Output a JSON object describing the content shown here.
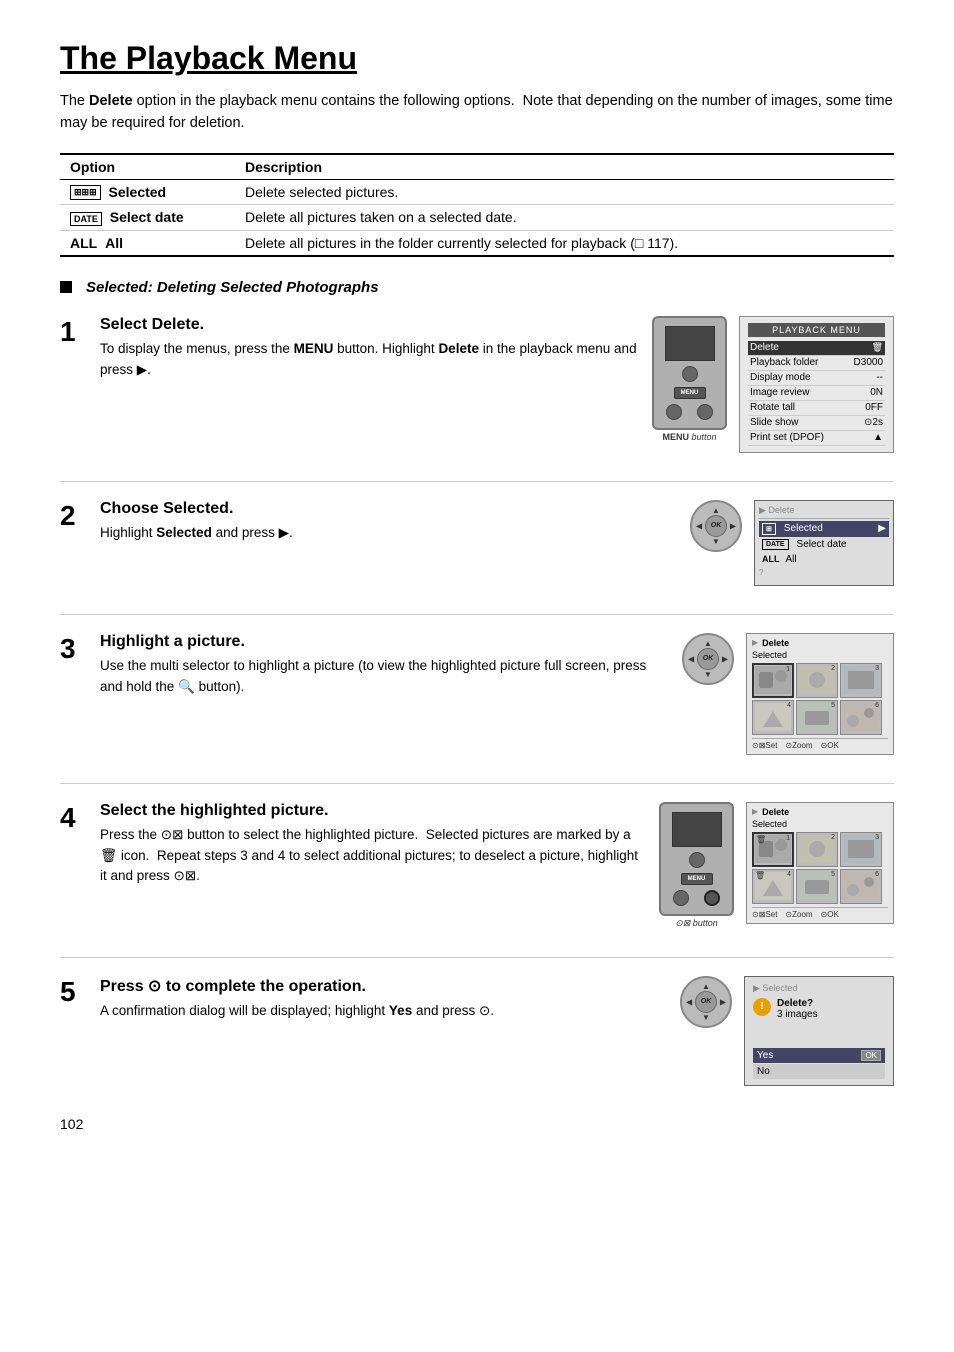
{
  "page": {
    "title": "The Playback Menu",
    "page_number": "102",
    "intro": "The Delete option in the playback menu contains the following options.  Note that depending on the number of images, some time may be required for deletion.",
    "table": {
      "headers": [
        "Option",
        "Description"
      ],
      "rows": [
        {
          "icon": "BBB",
          "option": "Selected",
          "description": "Delete selected pictures."
        },
        {
          "icon": "DATE",
          "option": "Select date",
          "description": "Delete all pictures taken on a selected date."
        },
        {
          "icon": "ALL",
          "option": "All",
          "description": "Delete all pictures in the folder currently selected for playback (□ 117)."
        }
      ]
    },
    "section_heading": "Selected: Deleting Selected Photographs",
    "steps": [
      {
        "number": "1",
        "title": "Select Delete.",
        "body": "To display the menus, press the MENU button. Highlight Delete in the playback menu and press ▶.",
        "button_label": "MENU button",
        "screen": {
          "title": "PLAYBACK MENU",
          "rows": [
            {
              "label": "Delete",
              "value": "",
              "highlighted": true
            },
            {
              "label": "Playback folder",
              "value": "D3000"
            },
            {
              "label": "Display mode",
              "value": "--"
            },
            {
              "label": "Image review",
              "value": "0N"
            },
            {
              "label": "Rotate tall",
              "value": "0FF"
            },
            {
              "label": "Slide show",
              "value": "⊙2s"
            },
            {
              "label": "Print set (DPOF)",
              "value": "▲"
            }
          ]
        }
      },
      {
        "number": "2",
        "title": "Choose Selected.",
        "body": "Highlight Selected and press ▶.",
        "screen": {
          "title": "Delete",
          "rows": [
            {
              "label": "Selected",
              "value": "▶",
              "highlighted": true,
              "icon": "BBB"
            },
            {
              "label": "Select date",
              "value": "",
              "icon": "DATE"
            },
            {
              "label": "All  All",
              "value": "",
              "icon": ""
            }
          ]
        }
      },
      {
        "number": "3",
        "title": "Highlight a picture.",
        "body": "Use the multi selector to highlight a picture (to view the highlighted picture full screen, press and hold the 🔍 button).",
        "screen": {
          "title": "Delete",
          "subtitle": "Selected",
          "has_thumbnails": true,
          "footer": "⊙⊠Set  ⊙Zoom  ⊙OK"
        }
      },
      {
        "number": "4",
        "title": "Select the highlighted picture.",
        "body": "Press the ⊙⊠ button to select the highlighted picture.  Selected pictures are marked by a 🗑 icon.  Repeat steps 3 and 4 to select additional pictures; to deselect a picture, highlight it and press ⊙⊠.",
        "button_label": "⊙⊠ button",
        "screen": {
          "title": "Delete",
          "subtitle": "Selected",
          "has_thumbnails": true,
          "has_delete_marks": true,
          "footer": "⊙⊠Set  ⊙Zoom  ⊙OK"
        }
      },
      {
        "number": "5",
        "title": "Press ⊙ to complete the operation.",
        "body": "A confirmation dialog will be displayed; highlight Yes and press ⊙.",
        "screen": {
          "title": "Selected",
          "confirm": {
            "icon": "!",
            "message": "Delete?",
            "sub": "3 images",
            "yes": "Yes",
            "yes_badge": "OK",
            "no": "No"
          }
        }
      }
    ]
  }
}
